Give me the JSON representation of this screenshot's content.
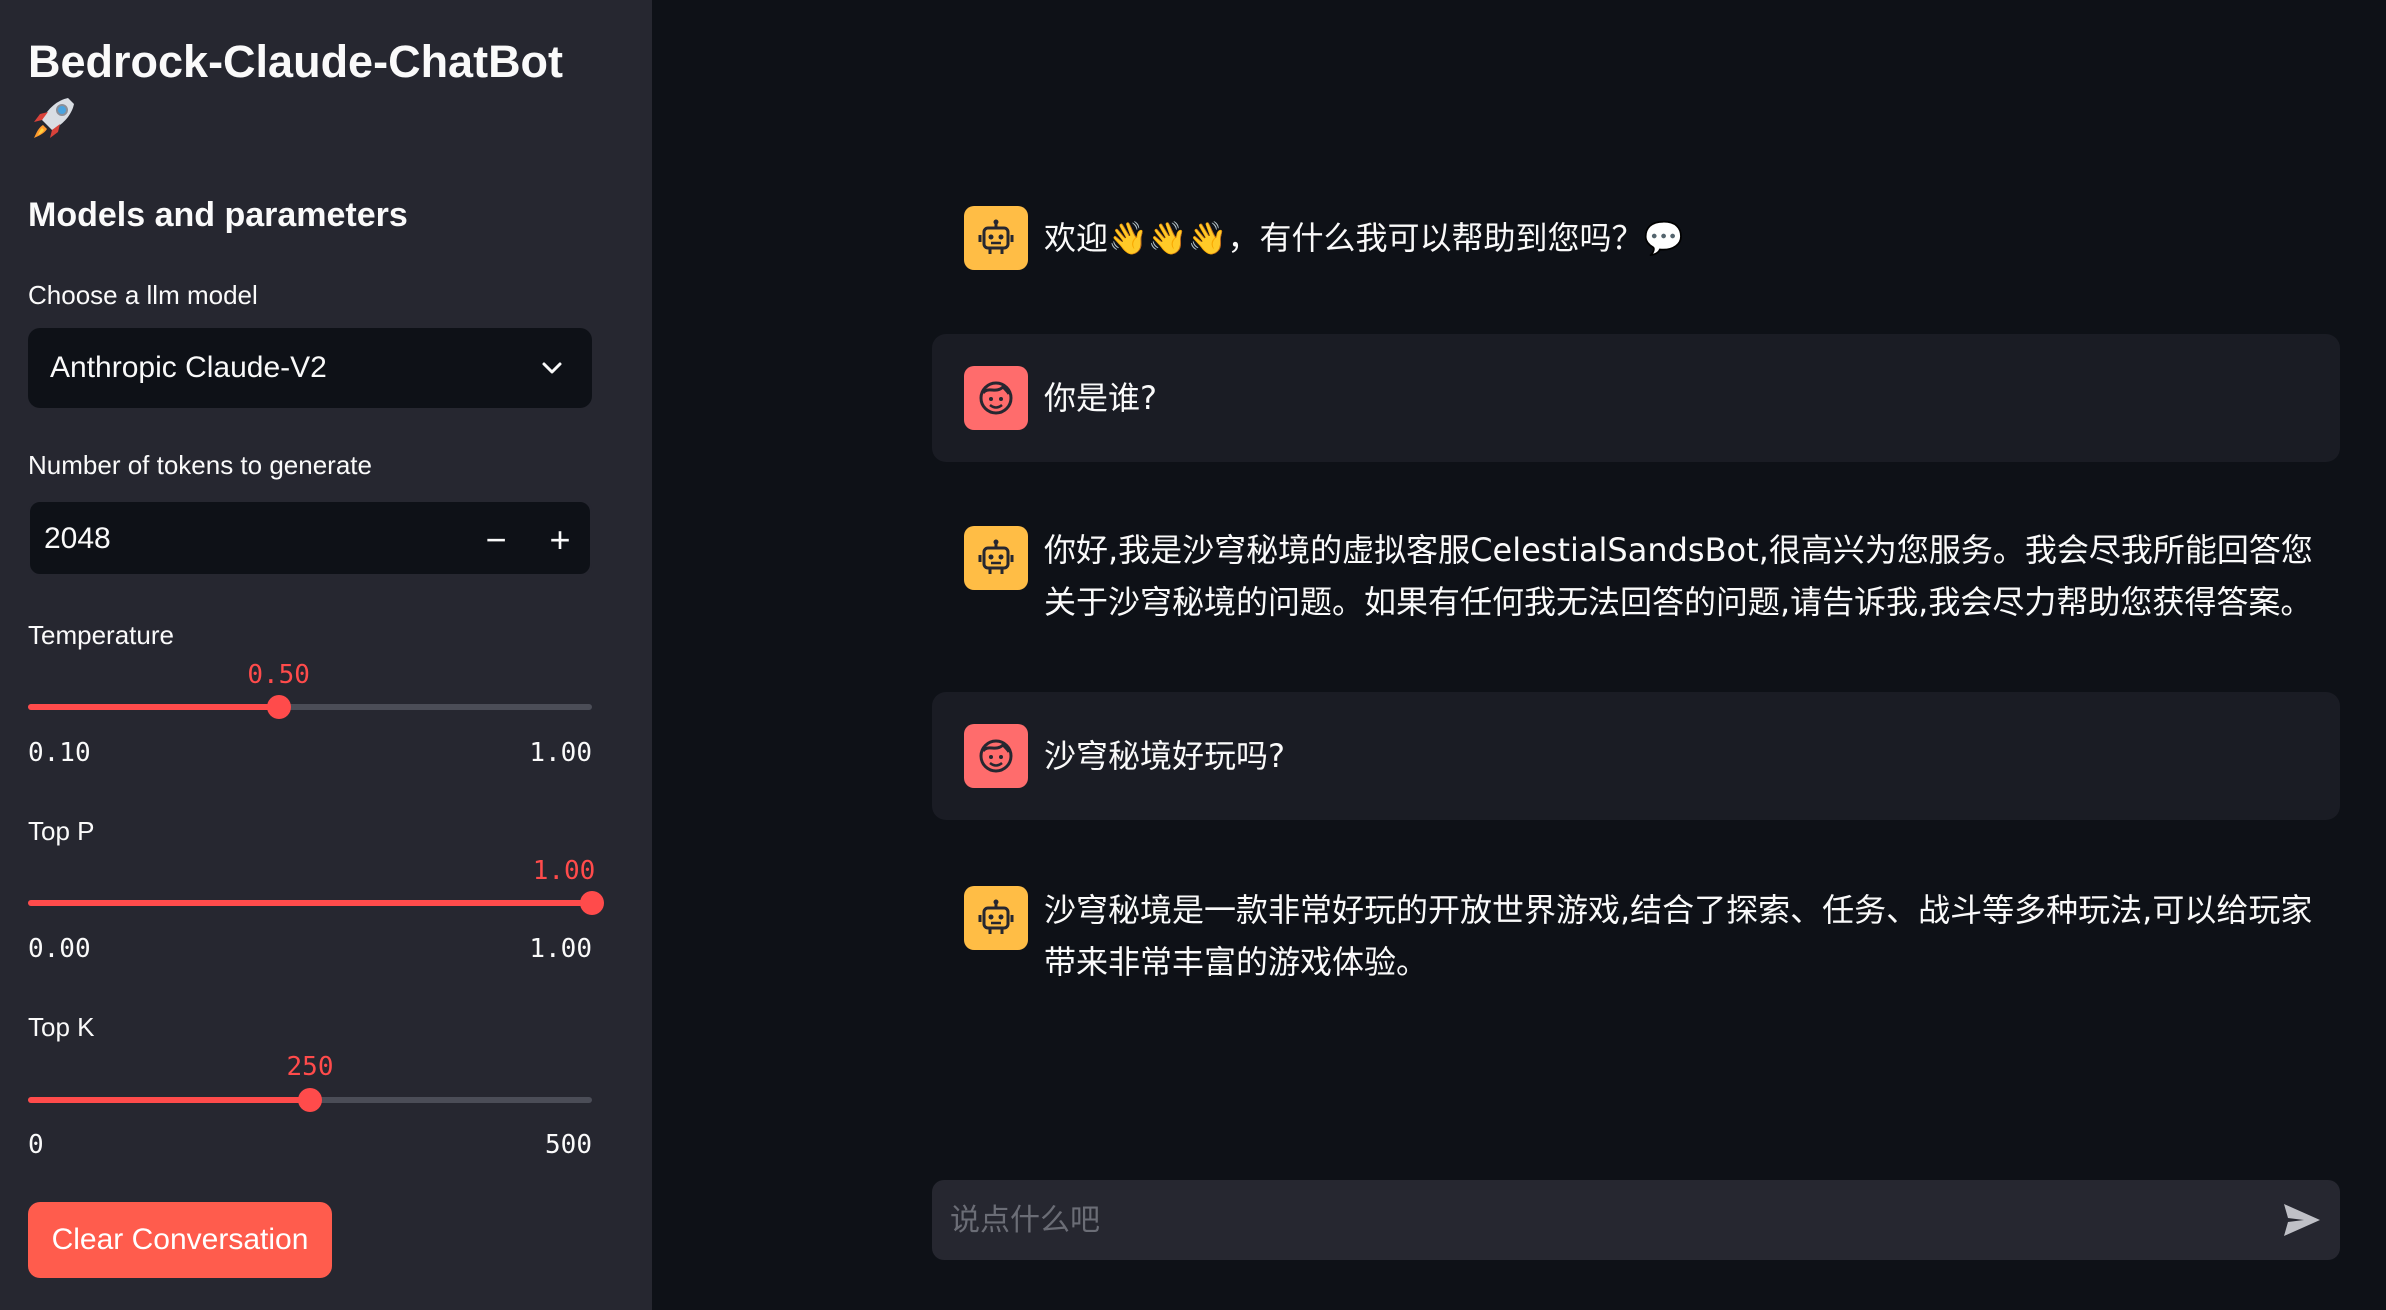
{
  "sidebar": {
    "app_title": "Bedrock-Claude-ChatBot",
    "title_icon": "rocket-icon",
    "section_title": "Models and parameters",
    "model_label": "Choose a llm model",
    "model_selected": "Anthropic Claude-V2",
    "tokens_label": "Number of tokens to generate",
    "tokens_value": "2048",
    "minus": "−",
    "plus": "+",
    "temperature": {
      "label": "Temperature",
      "value": "0.50",
      "min": "0.10",
      "max": "1.00",
      "fraction": 0.4444
    },
    "top_p": {
      "label": "Top P",
      "value": "1.00",
      "min": "0.00",
      "max": "1.00",
      "fraction": 1.0
    },
    "top_k": {
      "label": "Top K",
      "value": "250",
      "min": "0",
      "max": "500",
      "fraction": 0.5
    },
    "clear_button": "Clear Conversation"
  },
  "chat": {
    "messages": [
      {
        "role": "assistant",
        "text": "欢迎👋👋👋，有什么我可以帮助到您吗？💬"
      },
      {
        "role": "user",
        "text": "你是谁?"
      },
      {
        "role": "assistant",
        "text": "你好,我是沙穹秘境的虚拟客服CelestialSandsBot,很高兴为您服务。我会尽我所能回答您关于沙穹秘境的问题。如果有任何我无法回答的问题,请告诉我,我会尽力帮助您获得答案。"
      },
      {
        "role": "user",
        "text": "沙穹秘境好玩吗?"
      },
      {
        "role": "assistant",
        "text": "沙穹秘境是一款非常好玩的开放世界游戏,结合了探索、任务、战斗等多种玩法,可以给玩家带来非常丰富的游戏体验。"
      }
    ],
    "input_placeholder": "说点什么吧"
  },
  "colors": {
    "sidebar_bg": "#262730",
    "main_bg": "#0e1117",
    "accent": "#ff4b4b",
    "bot_avatar": "#ffbd45",
    "user_avatar": "#ff6c6c"
  }
}
